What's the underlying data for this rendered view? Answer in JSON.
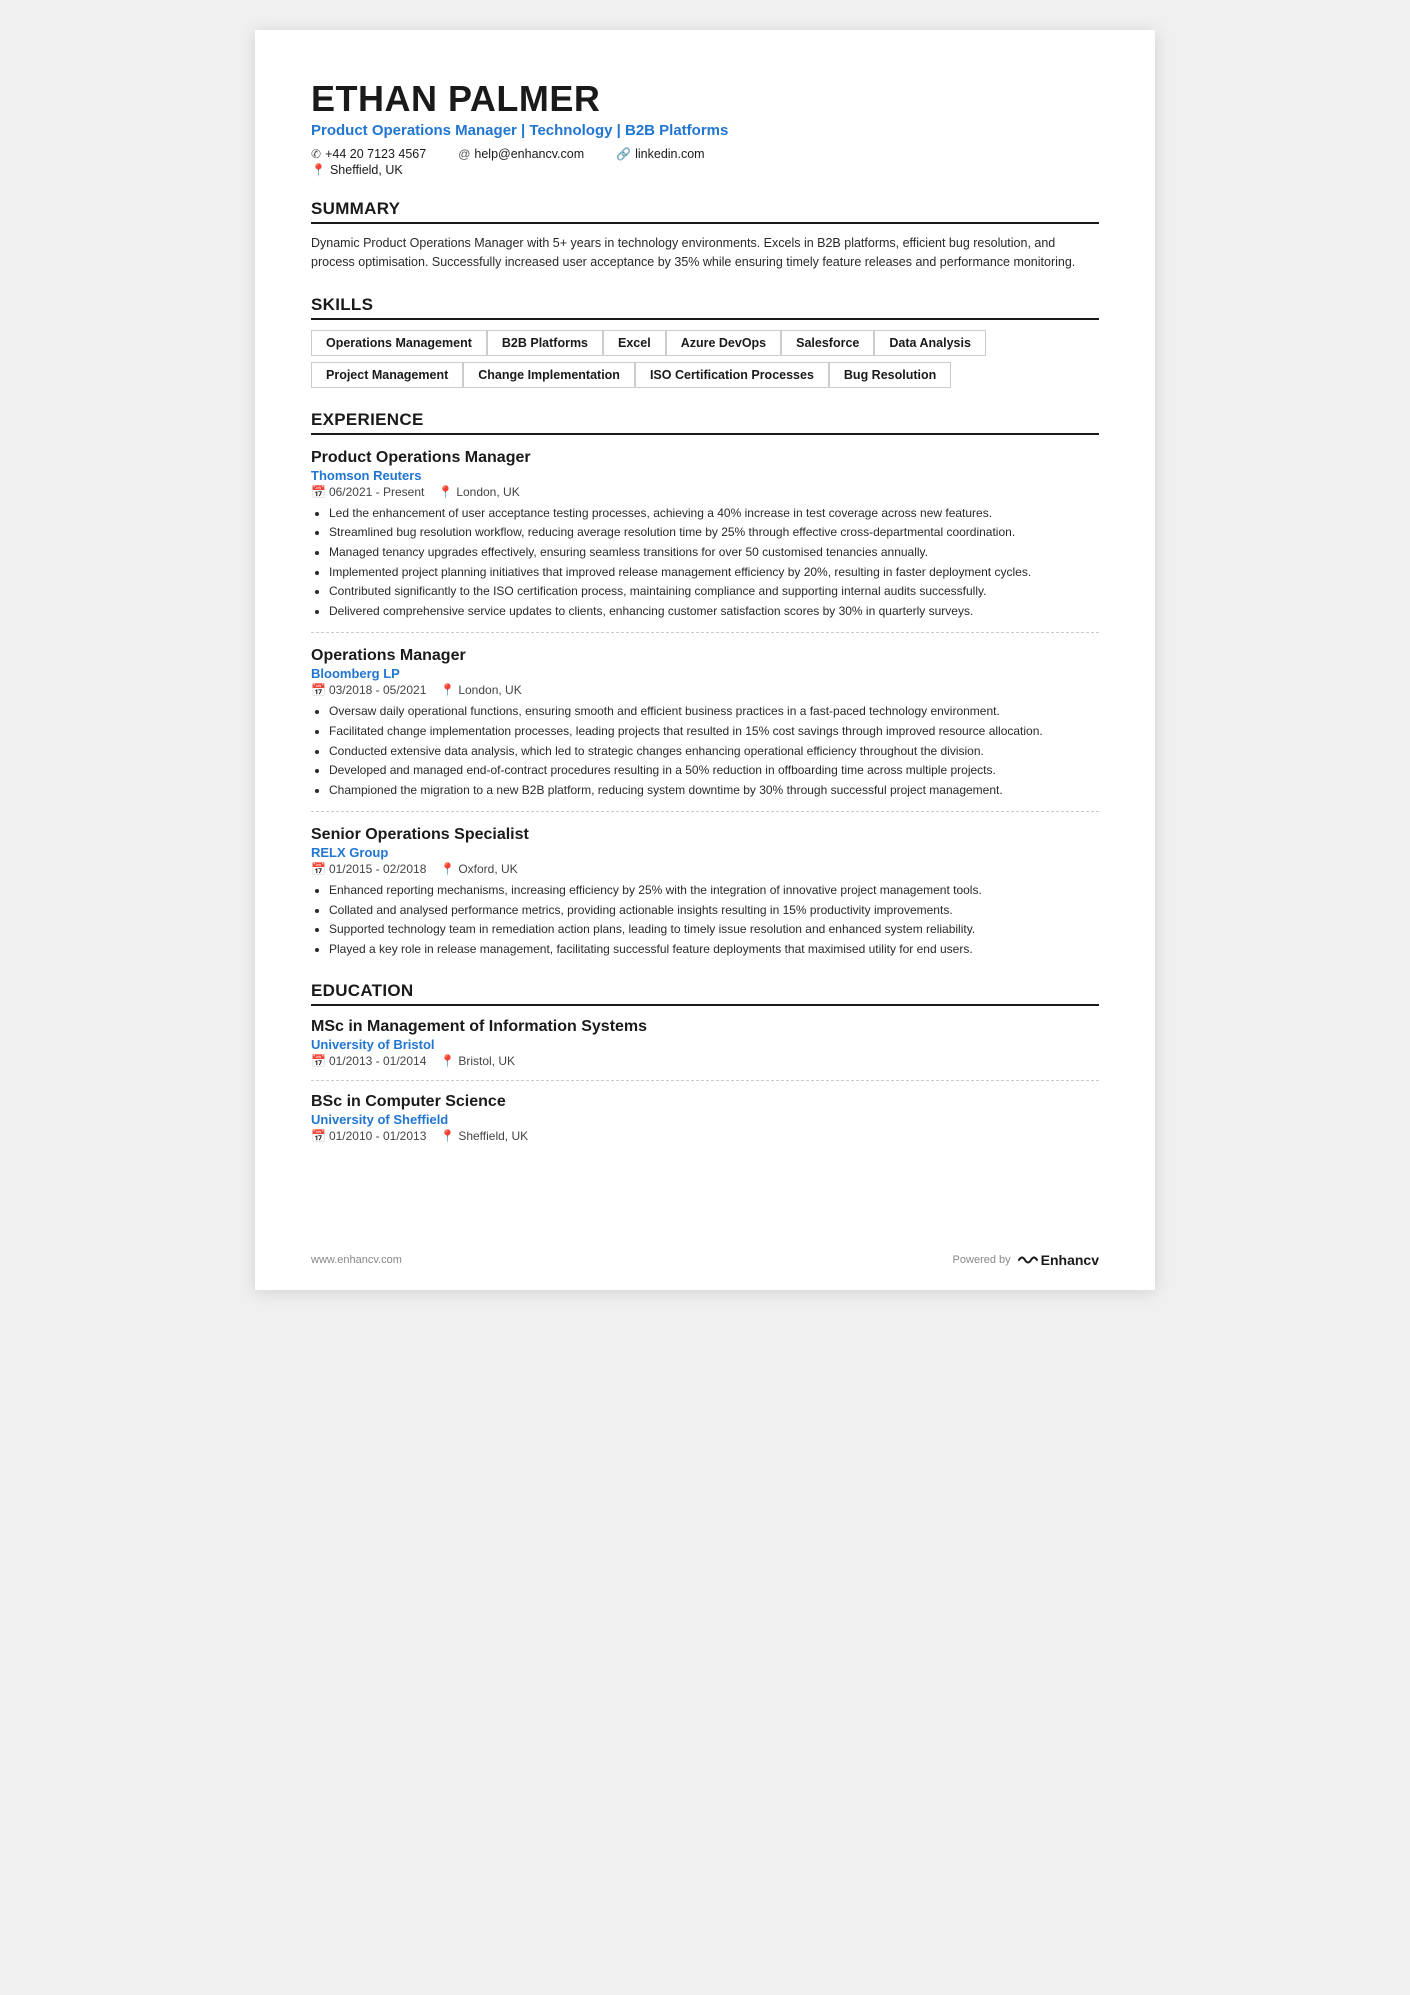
{
  "header": {
    "name": "ETHAN PALMER",
    "title": "Product Operations Manager | Technology | B2B Platforms",
    "phone": "+44 20 7123 4567",
    "email": "help@enhancv.com",
    "linkedin": "linkedin.com",
    "location": "Sheffield, UK"
  },
  "summary": {
    "section_title": "SUMMARY",
    "text": "Dynamic Product Operations Manager with 5+ years in technology environments. Excels in B2B platforms, efficient bug resolution, and process optimisation. Successfully increased user acceptance by 35% while ensuring timely feature releases and performance monitoring."
  },
  "skills": {
    "section_title": "SKILLS",
    "rows": [
      [
        "Operations Management",
        "B2B Platforms",
        "Excel",
        "Azure DevOps",
        "Salesforce",
        "Data Analysis"
      ],
      [
        "Project Management",
        "Change Implementation",
        "ISO Certification Processes",
        "Bug Resolution"
      ]
    ]
  },
  "experience": {
    "section_title": "EXPERIENCE",
    "jobs": [
      {
        "title": "Product Operations Manager",
        "company": "Thomson Reuters",
        "dates": "06/2021 - Present",
        "location": "London, UK",
        "bullets": [
          "Led the enhancement of user acceptance testing processes, achieving a 40% increase in test coverage across new features.",
          "Streamlined bug resolution workflow, reducing average resolution time by 25% through effective cross-departmental coordination.",
          "Managed tenancy upgrades effectively, ensuring seamless transitions for over 50 customised tenancies annually.",
          "Implemented project planning initiatives that improved release management efficiency by 20%, resulting in faster deployment cycles.",
          "Contributed significantly to the ISO certification process, maintaining compliance and supporting internal audits successfully.",
          "Delivered comprehensive service updates to clients, enhancing customer satisfaction scores by 30% in quarterly surveys."
        ]
      },
      {
        "title": "Operations Manager",
        "company": "Bloomberg LP",
        "dates": "03/2018 - 05/2021",
        "location": "London, UK",
        "bullets": [
          "Oversaw daily operational functions, ensuring smooth and efficient business practices in a fast-paced technology environment.",
          "Facilitated change implementation processes, leading projects that resulted in 15% cost savings through improved resource allocation.",
          "Conducted extensive data analysis, which led to strategic changes enhancing operational efficiency throughout the division.",
          "Developed and managed end-of-contract procedures resulting in a 50% reduction in offboarding time across multiple projects.",
          "Championed the migration to a new B2B platform, reducing system downtime by 30% through successful project management."
        ]
      },
      {
        "title": "Senior Operations Specialist",
        "company": "RELX Group",
        "dates": "01/2015 - 02/2018",
        "location": "Oxford, UK",
        "bullets": [
          "Enhanced reporting mechanisms, increasing efficiency by 25% with the integration of innovative project management tools.",
          "Collated and analysed performance metrics, providing actionable insights resulting in 15% productivity improvements.",
          "Supported technology team in remediation action plans, leading to timely issue resolution and enhanced system reliability.",
          "Played a key role in release management, facilitating successful feature deployments that maximised utility for end users."
        ]
      }
    ]
  },
  "education": {
    "section_title": "EDUCATION",
    "degrees": [
      {
        "degree": "MSc in Management of Information Systems",
        "school": "University of Bristol",
        "dates": "01/2013 - 01/2014",
        "location": "Bristol, UK"
      },
      {
        "degree": "BSc in Computer Science",
        "school": "University of Sheffield",
        "dates": "01/2010 - 01/2013",
        "location": "Sheffield, UK"
      }
    ]
  },
  "footer": {
    "url": "www.enhancv.com",
    "powered_by": "Powered by",
    "brand": "Enhancv"
  }
}
